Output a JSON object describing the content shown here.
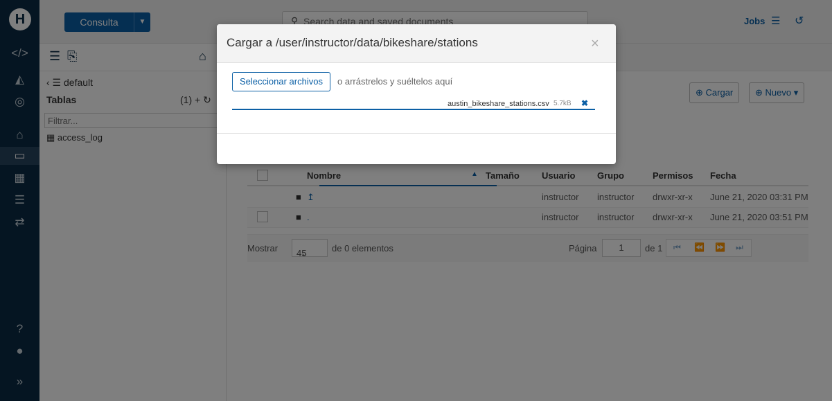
{
  "rail": {
    "items": [
      {
        "icon": "code-icon",
        "glyph": "</>"
      },
      {
        "icon": "chart-icon",
        "glyph": "📈"
      },
      {
        "icon": "dashboard-icon",
        "glyph": "◎"
      },
      {
        "icon": "docs-icon",
        "glyph": "🗀"
      },
      {
        "icon": "folder-icon",
        "glyph": "🗀"
      },
      {
        "icon": "table-icon",
        "glyph": "▦"
      },
      {
        "icon": "jobs-icon",
        "glyph": "☰"
      },
      {
        "icon": "transfer-icon",
        "glyph": "⇄"
      },
      {
        "icon": "help-icon",
        "glyph": "?"
      },
      {
        "icon": "info-icon",
        "glyph": "!"
      },
      {
        "icon": "expand-icon",
        "glyph": "»"
      }
    ]
  },
  "header": {
    "query_label": "Consulta",
    "search_placeholder": "Search data and saved documents",
    "jobs_label": "Jobs"
  },
  "assist": {
    "database": "default",
    "tables_label": "Tablas",
    "tables_count": "(1)",
    "filter_placeholder": "Filtrar...",
    "tables": [
      "access_log"
    ]
  },
  "main": {
    "upload_label": "Cargar",
    "new_label": "Nuevo",
    "columns": [
      "Nombre",
      "Tamaño",
      "Usuario",
      "Grupo",
      "Permisos",
      "Fecha"
    ],
    "rows": [
      {
        "name": "↥",
        "size": "",
        "user": "instructor",
        "group": "instructor",
        "perms": "drwxr-xr-x",
        "date": "June 21, 2020 03:31 PM"
      },
      {
        "name": ".",
        "size": "",
        "user": "instructor",
        "group": "instructor",
        "perms": "drwxr-xr-x",
        "date": "June 21, 2020 03:51 PM"
      }
    ],
    "pager": {
      "show_label": "Mostrar",
      "page_size": "45",
      "items_label": "de 0 elementos",
      "page_label": "Página",
      "page": "1",
      "of_label": "de 1"
    }
  },
  "modal": {
    "title": "Cargar a /user/instructor/data/bikeshare/stations",
    "select_files": "Seleccionar archivos",
    "drop_hint": "o arrástrelos y suéltelos aquí",
    "file_name": "austin_bikeshare_stations.csv",
    "file_size": "5.7kB",
    "progress": 1.0
  }
}
